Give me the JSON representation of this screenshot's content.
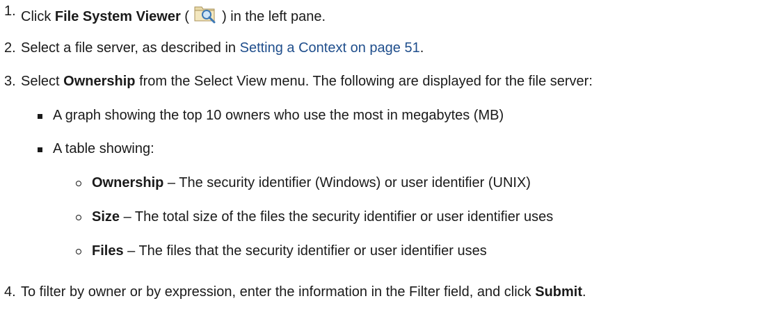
{
  "steps": [
    {
      "number": "1.",
      "prefix": "Click ",
      "bold": "File System Viewer",
      "middle": " ( ",
      "icon": "file-system-viewer-icon",
      "suffix": " ) in the left pane."
    },
    {
      "number": "2.",
      "prefix": "Select a file server, as described in ",
      "link": "Setting a Context on page 51",
      "suffix": "."
    },
    {
      "number": "3.",
      "prefix": "Select ",
      "bold": "Ownership",
      "suffix": " from the Select View menu. The following are displayed for the file server:"
    },
    {
      "number": "4.",
      "prefix": "To filter by owner or by expression, enter the information in the Filter field, and click ",
      "bold": "Submit",
      "suffix": "."
    }
  ],
  "bullets": [
    "A graph showing the top 10 owners who use the most in megabytes (MB)",
    "A table showing:"
  ],
  "subbullets": [
    {
      "term": "Ownership",
      "desc": " – The security identifier (Windows) or user identifier (UNIX)"
    },
    {
      "term": "Size",
      "desc": " – The total size of the files the security identifier or user identifier uses"
    },
    {
      "term": "Files",
      "desc": " – The files that the security identifier or user identifier uses"
    }
  ]
}
